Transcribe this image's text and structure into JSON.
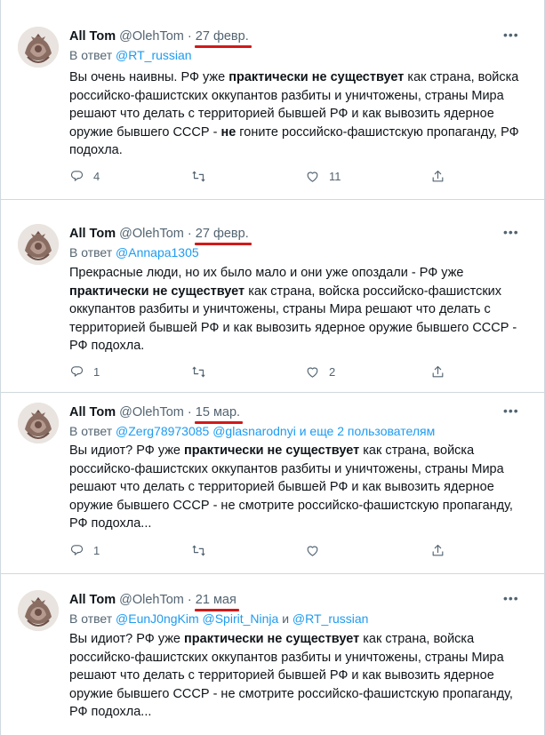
{
  "tweets": [
    {
      "name": "All Tom",
      "handle": "@OlehTom",
      "dot": "·",
      "date": "27 февр.",
      "reply_prefix": "В ответ",
      "mentions_text": "@RT_russian",
      "body": [
        {
          "t": "Вы очень наивны. РФ уже "
        },
        {
          "t": "практически не существует",
          "b": true
        },
        {
          "t": " как страна, войска  российско-фашистских оккупантов разбиты и уничтожены, страны Мира решают что делать с территорией  бывшей РФ и как вывозить ядерное оружие бывшего СССР - "
        },
        {
          "t": "не",
          "b": true
        },
        {
          "t": " гоните российско-фашистскую пропаганду, РФ подохла."
        }
      ],
      "replies": "4",
      "retweets": "",
      "likes": "11"
    },
    {
      "name": "All Tom",
      "handle": "@OlehTom",
      "dot": "·",
      "date": "27 февр.",
      "reply_prefix": "В ответ",
      "mentions_text": "@Annapa1305",
      "body": [
        {
          "t": "Прекрасные люди, но их было мало и они уже опоздали - РФ уже "
        },
        {
          "t": "практически не существует",
          "b": true
        },
        {
          "t": " как страна, войска  российско-фашистских оккупантов разбиты и уничтожены, страны Мира решают что делать с территорией  бывшей РФ и как вывозить ядерное оружие бывшего СССР - РФ подохла."
        }
      ],
      "replies": "1",
      "retweets": "",
      "likes": "2"
    },
    {
      "name": "All Tom",
      "handle": "@OlehTom",
      "dot": "·",
      "date": "15 мар.",
      "reply_prefix": "В ответ",
      "mentions_text": "@Zerg78973085 @glasnarodnyi",
      "mentions_suffix": "  и еще 2 пользователям",
      "body": [
        {
          "t": "Вы идиот? РФ уже "
        },
        {
          "t": "практически не существует",
          "b": true
        },
        {
          "t": " как страна, войска российско-фашистских оккупантов разбиты и уничтожены, страны Мира решают что делать с территорией  бывшей РФ и как вывозить ядерное оружие бывшего СССР - не смотрите российско-фашистскую пропаганду, РФ подохла..."
        }
      ],
      "replies": "1",
      "retweets": "",
      "likes": ""
    },
    {
      "name": "All Tom",
      "handle": "@OlehTom",
      "dot": "·",
      "date": "21 мая",
      "reply_prefix": "В ответ",
      "mentions_text": "@EunJ0ngKim @Spirit_Ninja",
      "mentions_and": " и ",
      "mentions_text2": "@RT_russian",
      "body": [
        {
          "t": "Вы идиот? РФ уже "
        },
        {
          "t": "практически не существует",
          "b": true
        },
        {
          "t": " как страна, войска российско-фашистских оккупантов разбиты и уничтожены, страны Мира решают что делать с территорией  бывшей РФ и как вывозить ядерное оружие бывшего СССР - не смотрите российско-фашистскую пропаганду, РФ подохла..."
        }
      ],
      "replies": "",
      "retweets": "",
      "likes": ""
    }
  ],
  "icons": {
    "more": "more-icon",
    "reply": "reply-icon",
    "retweet": "retweet-icon",
    "like": "like-icon",
    "share": "share-icon"
  },
  "colors": {
    "text": "#0f1419",
    "secondary": "#536471",
    "link": "#1d9bf0",
    "divider": "#cfd9de",
    "annotation_underline": "#d11a1a"
  }
}
